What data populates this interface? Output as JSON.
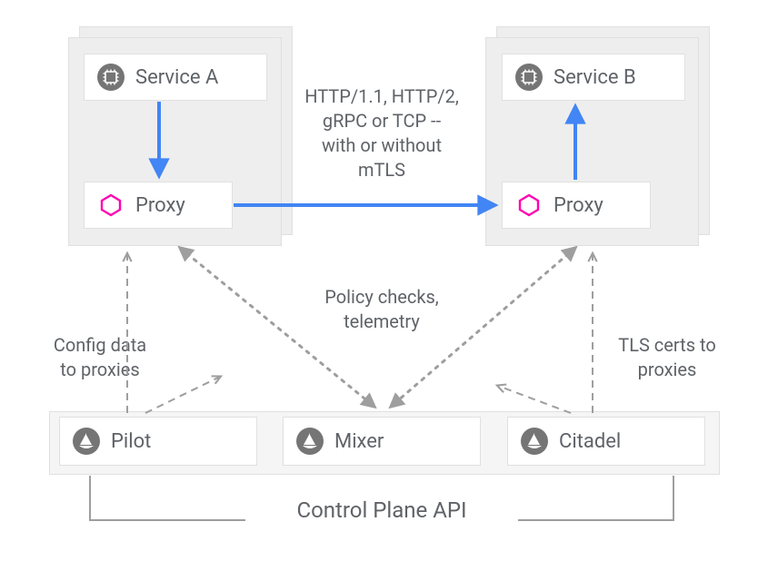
{
  "pods": {
    "serviceA": {
      "name": "Service A",
      "proxy": "Proxy"
    },
    "serviceB": {
      "name": "Service B",
      "proxy": "Proxy"
    }
  },
  "labels": {
    "protocols_line1": "HTTP/1.1, HTTP/2,",
    "protocols_line2": "gRPC or TCP --",
    "protocols_line3": "with or without",
    "protocols_line4": "mTLS",
    "policy_line1": "Policy checks,",
    "policy_line2": "telemetry",
    "config_line1": "Config data",
    "config_line2": "to proxies",
    "tls_line1": "TLS certs to",
    "tls_line2": "proxies"
  },
  "controlPlane": {
    "pilot": "Pilot",
    "mixer": "Mixer",
    "citadel": "Citadel",
    "api": "Control Plane API"
  },
  "colors": {
    "blue": "#4285f4",
    "magenta": "#ff00b0",
    "grey": "#9e9e9e",
    "textGrey": "#5f6368"
  }
}
